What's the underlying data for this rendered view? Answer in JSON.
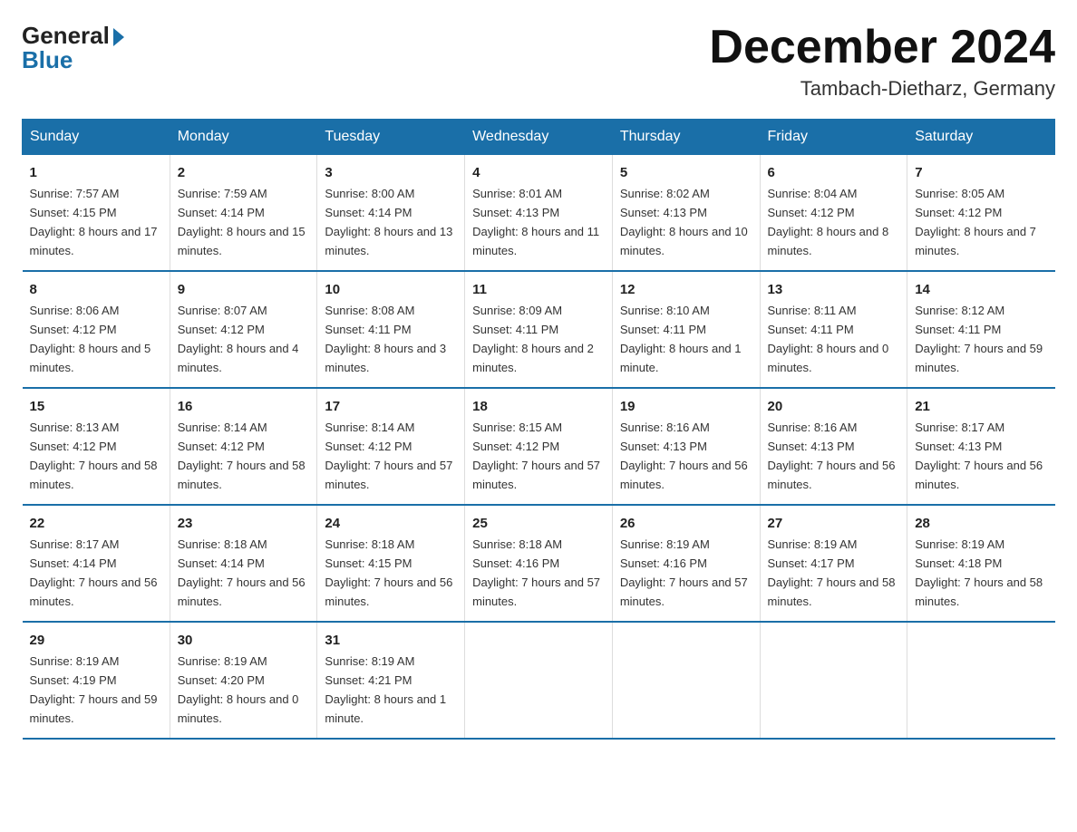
{
  "logo": {
    "general": "General",
    "arrow": "▶",
    "blue": "Blue"
  },
  "header": {
    "month_year": "December 2024",
    "location": "Tambach-Dietharz, Germany"
  },
  "days_of_week": [
    "Sunday",
    "Monday",
    "Tuesday",
    "Wednesday",
    "Thursday",
    "Friday",
    "Saturday"
  ],
  "weeks": [
    [
      {
        "day": "1",
        "sunrise": "Sunrise: 7:57 AM",
        "sunset": "Sunset: 4:15 PM",
        "daylight": "Daylight: 8 hours and 17 minutes."
      },
      {
        "day": "2",
        "sunrise": "Sunrise: 7:59 AM",
        "sunset": "Sunset: 4:14 PM",
        "daylight": "Daylight: 8 hours and 15 minutes."
      },
      {
        "day": "3",
        "sunrise": "Sunrise: 8:00 AM",
        "sunset": "Sunset: 4:14 PM",
        "daylight": "Daylight: 8 hours and 13 minutes."
      },
      {
        "day": "4",
        "sunrise": "Sunrise: 8:01 AM",
        "sunset": "Sunset: 4:13 PM",
        "daylight": "Daylight: 8 hours and 11 minutes."
      },
      {
        "day": "5",
        "sunrise": "Sunrise: 8:02 AM",
        "sunset": "Sunset: 4:13 PM",
        "daylight": "Daylight: 8 hours and 10 minutes."
      },
      {
        "day": "6",
        "sunrise": "Sunrise: 8:04 AM",
        "sunset": "Sunset: 4:12 PM",
        "daylight": "Daylight: 8 hours and 8 minutes."
      },
      {
        "day": "7",
        "sunrise": "Sunrise: 8:05 AM",
        "sunset": "Sunset: 4:12 PM",
        "daylight": "Daylight: 8 hours and 7 minutes."
      }
    ],
    [
      {
        "day": "8",
        "sunrise": "Sunrise: 8:06 AM",
        "sunset": "Sunset: 4:12 PM",
        "daylight": "Daylight: 8 hours and 5 minutes."
      },
      {
        "day": "9",
        "sunrise": "Sunrise: 8:07 AM",
        "sunset": "Sunset: 4:12 PM",
        "daylight": "Daylight: 8 hours and 4 minutes."
      },
      {
        "day": "10",
        "sunrise": "Sunrise: 8:08 AM",
        "sunset": "Sunset: 4:11 PM",
        "daylight": "Daylight: 8 hours and 3 minutes."
      },
      {
        "day": "11",
        "sunrise": "Sunrise: 8:09 AM",
        "sunset": "Sunset: 4:11 PM",
        "daylight": "Daylight: 8 hours and 2 minutes."
      },
      {
        "day": "12",
        "sunrise": "Sunrise: 8:10 AM",
        "sunset": "Sunset: 4:11 PM",
        "daylight": "Daylight: 8 hours and 1 minute."
      },
      {
        "day": "13",
        "sunrise": "Sunrise: 8:11 AM",
        "sunset": "Sunset: 4:11 PM",
        "daylight": "Daylight: 8 hours and 0 minutes."
      },
      {
        "day": "14",
        "sunrise": "Sunrise: 8:12 AM",
        "sunset": "Sunset: 4:11 PM",
        "daylight": "Daylight: 7 hours and 59 minutes."
      }
    ],
    [
      {
        "day": "15",
        "sunrise": "Sunrise: 8:13 AM",
        "sunset": "Sunset: 4:12 PM",
        "daylight": "Daylight: 7 hours and 58 minutes."
      },
      {
        "day": "16",
        "sunrise": "Sunrise: 8:14 AM",
        "sunset": "Sunset: 4:12 PM",
        "daylight": "Daylight: 7 hours and 58 minutes."
      },
      {
        "day": "17",
        "sunrise": "Sunrise: 8:14 AM",
        "sunset": "Sunset: 4:12 PM",
        "daylight": "Daylight: 7 hours and 57 minutes."
      },
      {
        "day": "18",
        "sunrise": "Sunrise: 8:15 AM",
        "sunset": "Sunset: 4:12 PM",
        "daylight": "Daylight: 7 hours and 57 minutes."
      },
      {
        "day": "19",
        "sunrise": "Sunrise: 8:16 AM",
        "sunset": "Sunset: 4:13 PM",
        "daylight": "Daylight: 7 hours and 56 minutes."
      },
      {
        "day": "20",
        "sunrise": "Sunrise: 8:16 AM",
        "sunset": "Sunset: 4:13 PM",
        "daylight": "Daylight: 7 hours and 56 minutes."
      },
      {
        "day": "21",
        "sunrise": "Sunrise: 8:17 AM",
        "sunset": "Sunset: 4:13 PM",
        "daylight": "Daylight: 7 hours and 56 minutes."
      }
    ],
    [
      {
        "day": "22",
        "sunrise": "Sunrise: 8:17 AM",
        "sunset": "Sunset: 4:14 PM",
        "daylight": "Daylight: 7 hours and 56 minutes."
      },
      {
        "day": "23",
        "sunrise": "Sunrise: 8:18 AM",
        "sunset": "Sunset: 4:14 PM",
        "daylight": "Daylight: 7 hours and 56 minutes."
      },
      {
        "day": "24",
        "sunrise": "Sunrise: 8:18 AM",
        "sunset": "Sunset: 4:15 PM",
        "daylight": "Daylight: 7 hours and 56 minutes."
      },
      {
        "day": "25",
        "sunrise": "Sunrise: 8:18 AM",
        "sunset": "Sunset: 4:16 PM",
        "daylight": "Daylight: 7 hours and 57 minutes."
      },
      {
        "day": "26",
        "sunrise": "Sunrise: 8:19 AM",
        "sunset": "Sunset: 4:16 PM",
        "daylight": "Daylight: 7 hours and 57 minutes."
      },
      {
        "day": "27",
        "sunrise": "Sunrise: 8:19 AM",
        "sunset": "Sunset: 4:17 PM",
        "daylight": "Daylight: 7 hours and 58 minutes."
      },
      {
        "day": "28",
        "sunrise": "Sunrise: 8:19 AM",
        "sunset": "Sunset: 4:18 PM",
        "daylight": "Daylight: 7 hours and 58 minutes."
      }
    ],
    [
      {
        "day": "29",
        "sunrise": "Sunrise: 8:19 AM",
        "sunset": "Sunset: 4:19 PM",
        "daylight": "Daylight: 7 hours and 59 minutes."
      },
      {
        "day": "30",
        "sunrise": "Sunrise: 8:19 AM",
        "sunset": "Sunset: 4:20 PM",
        "daylight": "Daylight: 8 hours and 0 minutes."
      },
      {
        "day": "31",
        "sunrise": "Sunrise: 8:19 AM",
        "sunset": "Sunset: 4:21 PM",
        "daylight": "Daylight: 8 hours and 1 minute."
      },
      null,
      null,
      null,
      null
    ]
  ]
}
